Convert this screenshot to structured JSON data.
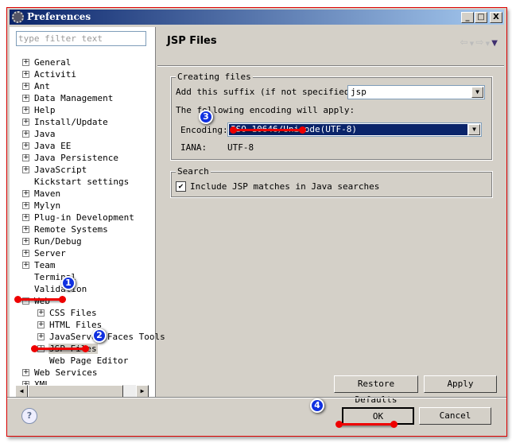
{
  "window": {
    "title": "Preferences",
    "minimize": "_",
    "maximize": "□",
    "close": "X"
  },
  "filter": {
    "placeholder": "type filter text"
  },
  "tree": [
    {
      "label": "General",
      "level": 0,
      "exp": "+"
    },
    {
      "label": "Activiti",
      "level": 0,
      "exp": "+"
    },
    {
      "label": "Ant",
      "level": 0,
      "exp": "+"
    },
    {
      "label": "Data Management",
      "level": 0,
      "exp": "+"
    },
    {
      "label": "Help",
      "level": 0,
      "exp": "+"
    },
    {
      "label": "Install/Update",
      "level": 0,
      "exp": "+"
    },
    {
      "label": "Java",
      "level": 0,
      "exp": "+"
    },
    {
      "label": "Java EE",
      "level": 0,
      "exp": "+"
    },
    {
      "label": "Java Persistence",
      "level": 0,
      "exp": "+"
    },
    {
      "label": "JavaScript",
      "level": 0,
      "exp": "+"
    },
    {
      "label": "Kickstart settings",
      "level": 0,
      "exp": ""
    },
    {
      "label": "Maven",
      "level": 0,
      "exp": "+"
    },
    {
      "label": "Mylyn",
      "level": 0,
      "exp": "+"
    },
    {
      "label": "Plug-in Development",
      "level": 0,
      "exp": "+"
    },
    {
      "label": "Remote Systems",
      "level": 0,
      "exp": "+"
    },
    {
      "label": "Run/Debug",
      "level": 0,
      "exp": "+"
    },
    {
      "label": "Server",
      "level": 0,
      "exp": "+"
    },
    {
      "label": "Team",
      "level": 0,
      "exp": "+"
    },
    {
      "label": "Terminal",
      "level": 0,
      "exp": ""
    },
    {
      "label": "Validation",
      "level": 0,
      "exp": ""
    },
    {
      "label": "Web",
      "level": 0,
      "exp": "-"
    },
    {
      "label": "CSS Files",
      "level": 1,
      "exp": "+"
    },
    {
      "label": "HTML Files",
      "level": 1,
      "exp": "+"
    },
    {
      "label": "JavaServer Faces Tools",
      "level": 1,
      "exp": "+"
    },
    {
      "label": "JSP Files",
      "level": 1,
      "exp": "+",
      "selected": true
    },
    {
      "label": "Web Page Editor",
      "level": 1,
      "exp": ""
    },
    {
      "label": "Web Services",
      "level": 0,
      "exp": "+"
    },
    {
      "label": "XML",
      "level": 0,
      "exp": "+"
    }
  ],
  "page": {
    "title": "JSP Files",
    "creating": {
      "legend": "Creating files",
      "suffix_label": "Add this suffix (if not specified):",
      "suffix_value": "jsp",
      "encoding_intro": "The following encoding will apply:",
      "encoding_label": "Encoding:",
      "encoding_value": "ISO 10646/Unicode(UTF-8)",
      "iana_label": "IANA:",
      "iana_value": "UTF-8"
    },
    "search": {
      "legend": "Search",
      "include_label": "Include JSP matches in Java searches",
      "include_checked": true
    },
    "restore_defaults": "Restore Defaults",
    "apply": "Apply"
  },
  "footer": {
    "ok": "OK",
    "cancel": "Cancel"
  },
  "annotations": [
    "1",
    "2",
    "3",
    "4"
  ],
  "colors": {
    "annotation_marker": "#e00000",
    "annotation_badge": "#1030e0",
    "title_bar": "#0a246a",
    "selection": "#0a246a"
  }
}
